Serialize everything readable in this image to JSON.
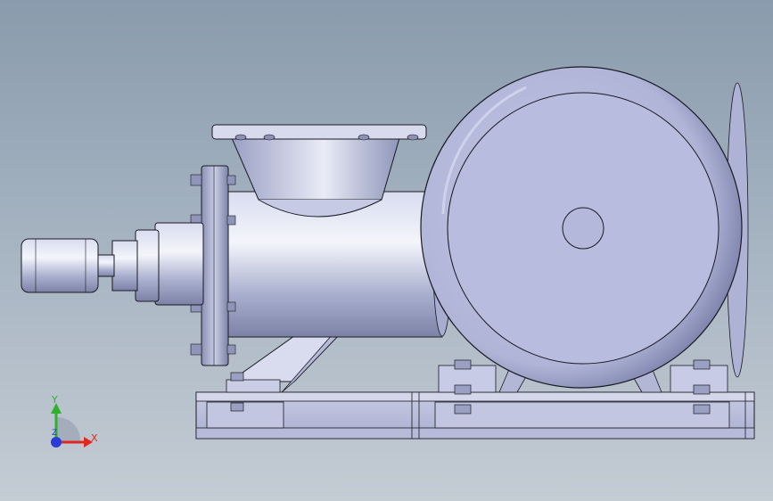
{
  "viewport": {
    "background_top": "#8a9bad",
    "background_bottom": "#c4ccd4"
  },
  "model": {
    "description_icon": "screw-pump-assembly",
    "body_color": "#b9bfdc",
    "edge_color": "#1a1a22"
  },
  "triad": {
    "x_label": "X",
    "y_label": "Y",
    "z_label": "Z",
    "x_color": "#e0281e",
    "y_color": "#2fb12f",
    "z_color": "#2b3bd6"
  }
}
